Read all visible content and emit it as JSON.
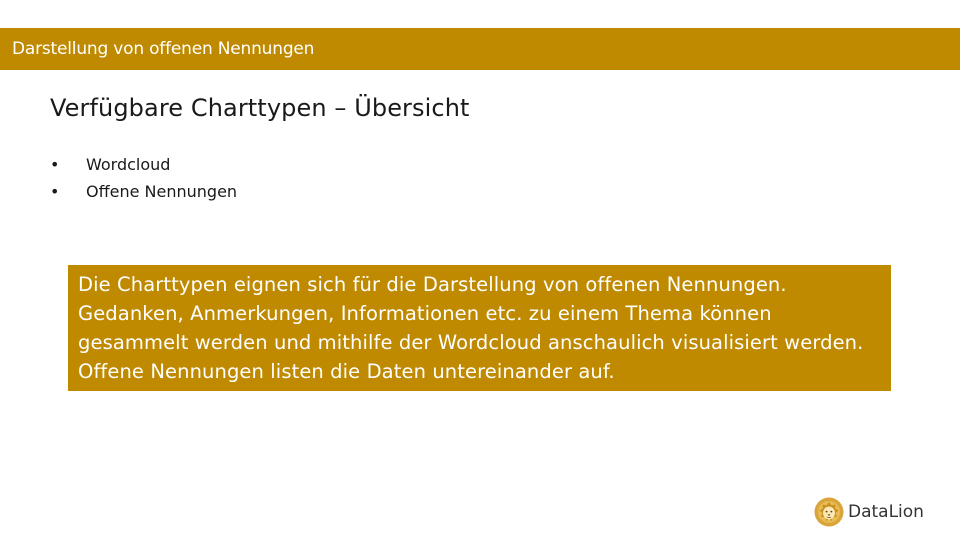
{
  "header": {
    "title": "Darstellung von offenen Nennungen"
  },
  "slide": {
    "title": "Verfügbare Charttypen – Übersicht",
    "bullets": [
      {
        "marker": "•",
        "label": "Wordcloud"
      },
      {
        "marker": "•",
        "label": "Offene Nennungen"
      }
    ]
  },
  "info_box": {
    "text": "Die Charttypen eignen sich für die Darstellung von offenen Nennungen. Gedanken, Anmerkungen, Informationen etc. zu einem Thema können gesammelt werden und mithilfe der Wordcloud anschaulich visualisiert werden. Offene Nennungen listen die Daten untereinander auf."
  },
  "logo": {
    "name": "DataLion",
    "icon": "lion-head-icon"
  },
  "colors": {
    "accent": "#bf8a00",
    "text": "#1a1a1a",
    "on_accent": "#ffffff"
  }
}
